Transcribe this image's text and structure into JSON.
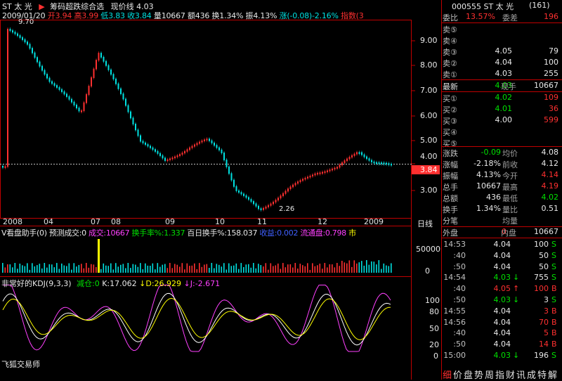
{
  "header": {
    "stock_name": "ST 太 光",
    "indicator_title": "筹码超跌综合选",
    "current_price_label": "现价线 4.03"
  },
  "info_bar": {
    "date": "2009/01/20",
    "open": "开3.94",
    "high": "高3.99",
    "low": "低3.83",
    "close": "收3.84",
    "volume": "量10667",
    "amount": "额436",
    "turnover": "换1.34%",
    "amplitude": "振4.13%",
    "change": "涨(-0.08)-2.16%",
    "index_label": "指数(3"
  },
  "price_axis": [
    "9.00",
    "8.00",
    "7.00",
    "6.00",
    "5.00",
    "4.00",
    "3.00"
  ],
  "price_marker": "3.84",
  "price_annotations": {
    "high": "9.70",
    "low": "2.26"
  },
  "time_axis": [
    "2008",
    "04",
    "07",
    "08",
    "09",
    "10",
    "11",
    "12",
    "2009"
  ],
  "period_label": "日线",
  "vol_panel": {
    "title": "V看盘助手(0)",
    "forecast": "预测成交:0",
    "volume": "成交:10667",
    "turnover_rate": "换手率%:1.337",
    "hundred_day": "百日换手%:158.037",
    "gain": "收益:0.002",
    "float_shares": "流通盘:0.798",
    "market": "市",
    "axis": [
      "50000",
      "0"
    ]
  },
  "kdj_panel": {
    "title": "非常好的KDJ(9,3,3)",
    "reduce": "减仓:0",
    "k": "K:17.062",
    "d": "D:26.929",
    "j": "J:-2.671",
    "axis": [
      "100",
      "80",
      "50",
      "20",
      "0"
    ],
    "watermark": "飞狐交易师"
  },
  "panel": {
    "code_name": "000555 ST 太 光",
    "page": "(161)",
    "weibi_label": "委比",
    "weibi_value": "13.57%",
    "weicha_label": "委差",
    "weicha_value": "196",
    "asks": [
      {
        "label": "卖⑤",
        "price": "",
        "vol": ""
      },
      {
        "label": "卖④",
        "price": "",
        "vol": ""
      },
      {
        "label": "卖③",
        "price": "4.05",
        "vol": "79"
      },
      {
        "label": "卖②",
        "price": "4.04",
        "vol": "100"
      },
      {
        "label": "卖①",
        "price": "4.03",
        "vol": "255"
      }
    ],
    "latest_label": "最新",
    "latest_price": "4.03",
    "xianshou_label": "现手",
    "xianshou_value": "10667",
    "bids": [
      {
        "label": "买①",
        "price": "4.02",
        "vol": "109"
      },
      {
        "label": "买②",
        "price": "4.01",
        "vol": "36"
      },
      {
        "label": "买③",
        "price": "4.00",
        "vol": "599"
      },
      {
        "label": "买④",
        "price": "",
        "vol": ""
      },
      {
        "label": "买⑤",
        "price": "",
        "vol": ""
      }
    ],
    "stats": [
      {
        "l1": "涨跌",
        "v1": "-0.09",
        "l2": "均价",
        "v2": "4.08",
        "c1": "green",
        "c2": "white"
      },
      {
        "l1": "涨幅",
        "v1": "-2.18%",
        "l2": "前收",
        "v2": "4.12",
        "c1": "white",
        "c2": "white"
      },
      {
        "l1": "振幅",
        "v1": "4.13%",
        "l2": "今开",
        "v2": "4.14",
        "c1": "white",
        "c2": "red"
      },
      {
        "l1": "总手",
        "v1": "10667",
        "l2": "最高",
        "v2": "4.19",
        "c1": "white",
        "c2": "red"
      },
      {
        "l1": "总额",
        "v1": "436",
        "l2": "最低",
        "v2": "4.02",
        "c1": "white",
        "c2": "green"
      },
      {
        "l1": "换手",
        "v1": "1.34%",
        "l2": "量比",
        "v2": "0.51",
        "c1": "white",
        "c2": "white"
      },
      {
        "l1": "分笔",
        "v1": "",
        "l2": "均量",
        "v2": "",
        "c1": "white",
        "c2": "white"
      }
    ],
    "outer_label": "外盘",
    "outer_value": "0",
    "inner_label": "内盘",
    "inner_value": "10667",
    "ticks": [
      {
        "time": "14:53",
        "price": "4.04",
        "arrow": "",
        "vol": "100",
        "side": "S",
        "pc": "white",
        "vc": "white"
      },
      {
        "time": ":40",
        "price": "4.04",
        "arrow": "",
        "vol": "50",
        "side": "S",
        "pc": "white",
        "vc": "white"
      },
      {
        "time": ":50",
        "price": "4.04",
        "arrow": "",
        "vol": "50",
        "side": "S",
        "pc": "white",
        "vc": "white"
      },
      {
        "time": "14:54",
        "price": "4.03",
        "arrow": "↓",
        "vol": "755",
        "side": "S",
        "pc": "green",
        "vc": "white"
      },
      {
        "time": ":40",
        "price": "4.05",
        "arrow": "↑",
        "vol": "100",
        "side": "B",
        "pc": "red",
        "vc": "red"
      },
      {
        "time": ":50",
        "price": "4.03",
        "arrow": "↓",
        "vol": "3",
        "side": "S",
        "pc": "green",
        "vc": "white"
      },
      {
        "time": "14:55",
        "price": "4.04",
        "arrow": "",
        "vol": "3",
        "side": "B",
        "pc": "white",
        "vc": "red"
      },
      {
        "time": "14:56",
        "price": "4.04",
        "arrow": "",
        "vol": "70",
        "side": "B",
        "pc": "white",
        "vc": "red"
      },
      {
        "time": ":40",
        "price": "4.04",
        "arrow": "",
        "vol": "5",
        "side": "B",
        "pc": "white",
        "vc": "red"
      },
      {
        "time": ":50",
        "price": "4.04",
        "arrow": "",
        "vol": "14",
        "side": "B",
        "pc": "white",
        "vc": "red"
      },
      {
        "time": "15:00",
        "price": "4.03",
        "arrow": "↓",
        "vol": "196",
        "side": "S",
        "pc": "green",
        "vc": "white"
      }
    ],
    "tabs": [
      "细",
      "价",
      "盘",
      "势",
      "周",
      "指",
      "财",
      "讯",
      "成",
      "特",
      "解"
    ]
  },
  "colors": {
    "up": "#ff3030",
    "down": "#00e0e0",
    "grid": "#c00000",
    "k_line": "#ffffff",
    "d_line": "#ffff00",
    "j_line": "#ff40ff"
  }
}
